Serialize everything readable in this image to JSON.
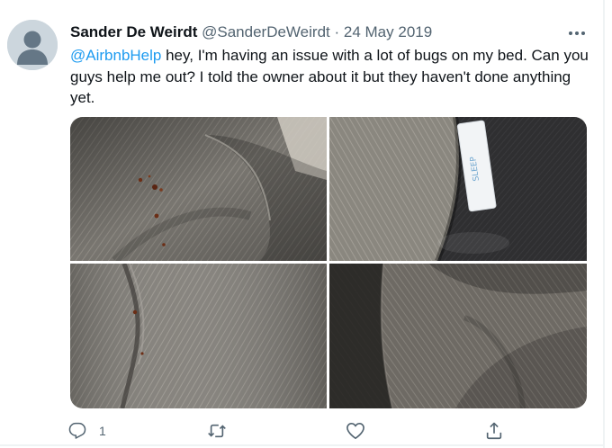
{
  "tweet": {
    "author_name": "Sander De Weirdt",
    "author_handle": "@SanderDeWeirdt",
    "separator": "·",
    "date": "24 May 2019",
    "text_mention": "@AirbnbHelp",
    "text_body": " hey, I'm having an issue with a lot of bugs on my bed. Can you guys help me out? I told the owner about it but they haven't done anything yet.",
    "photo_label_text": "SLEEP"
  },
  "actions": {
    "reply_icon": "reply-icon",
    "reply_count": "1",
    "retweet_icon": "retweet-icon",
    "like_icon": "heart-icon",
    "share_icon": "share-icon"
  },
  "colors": {
    "mention": "#1d9bf0",
    "secondary_text": "#536471",
    "primary_text": "#0f1419",
    "avatar_bg": "#ccd6dd"
  }
}
